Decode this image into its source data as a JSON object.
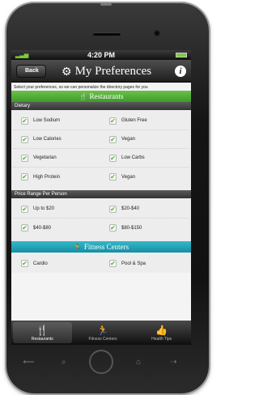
{
  "status": {
    "time": "4:20 PM"
  },
  "nav": {
    "back_label": "Back",
    "title": "My Preferences"
  },
  "subtitle": "Select your preferences, so we can personalize the directory pages for you",
  "restaurants": {
    "banner": "Restaurants",
    "dietary": {
      "header": "Dietary",
      "rows": [
        [
          "Low Sodium",
          "Gluten Free"
        ],
        [
          "Low Calories",
          "Vegan"
        ],
        [
          "Vegetarian",
          "Low Carbs"
        ],
        [
          "High Protein",
          "Vegan"
        ]
      ]
    },
    "price": {
      "header": "Price Range Per Person",
      "rows": [
        [
          "Up to $20",
          "$20-$40"
        ],
        [
          "$40-$80",
          "$80-$150"
        ]
      ]
    }
  },
  "fitness": {
    "banner": "Fitness Centers",
    "rows": [
      [
        "Cardio",
        "Pool & Spa"
      ]
    ]
  },
  "tabs": [
    "Restaurants",
    "Fitness Centers",
    "Health Tips"
  ],
  "colors": {
    "green": "#4aad33",
    "teal": "#1fa3b8",
    "check": "#58b030"
  }
}
